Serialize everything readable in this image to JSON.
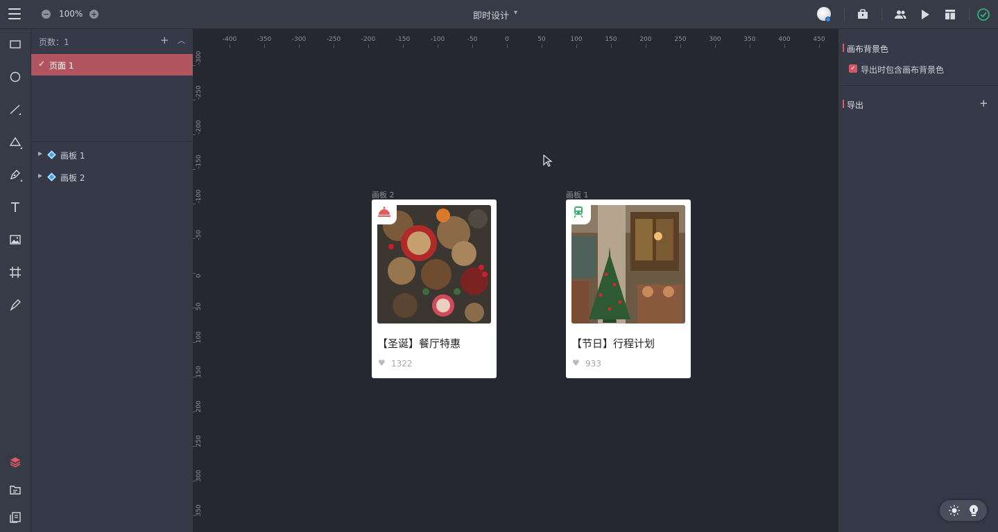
{
  "topbar": {
    "zoom_value": "100%",
    "doc_title": "即时设计"
  },
  "pages_panel": {
    "header": "页数：1",
    "pages": [
      {
        "label": "页面 1"
      }
    ],
    "layers": [
      {
        "label": "画板 1"
      },
      {
        "label": "画板 2"
      }
    ]
  },
  "canvas": {
    "ruler_x": [
      "-400",
      "-350",
      "-300",
      "-250",
      "-200",
      "-150",
      "-100",
      "-50",
      "0",
      "50",
      "100",
      "150",
      "200",
      "250",
      "300",
      "350",
      "400",
      "450"
    ],
    "ruler_y": [
      "-300",
      "-250",
      "-200",
      "-150",
      "-100",
      "-50",
      "0",
      "50",
      "100",
      "150",
      "200",
      "250",
      "300",
      "350"
    ],
    "artboards": [
      {
        "label": "画板 2",
        "title": "【圣诞】餐厅特惠",
        "likes": "1322",
        "badge_icon": "dish-cover-icon",
        "badge_color": "#e35b5b"
      },
      {
        "label": "画板 1",
        "title": "【节日】行程计划",
        "likes": "933",
        "badge_icon": "train-icon",
        "badge_color": "#3fae6b"
      }
    ]
  },
  "right_panel": {
    "canvas_bg_title": "画布背景色",
    "include_bg_label": "导出时包含画布背景色",
    "export_title": "导出"
  },
  "colors": {
    "accent": "#b35560",
    "status_ok": "#2fb37a",
    "layer_active": "#e05a63"
  }
}
